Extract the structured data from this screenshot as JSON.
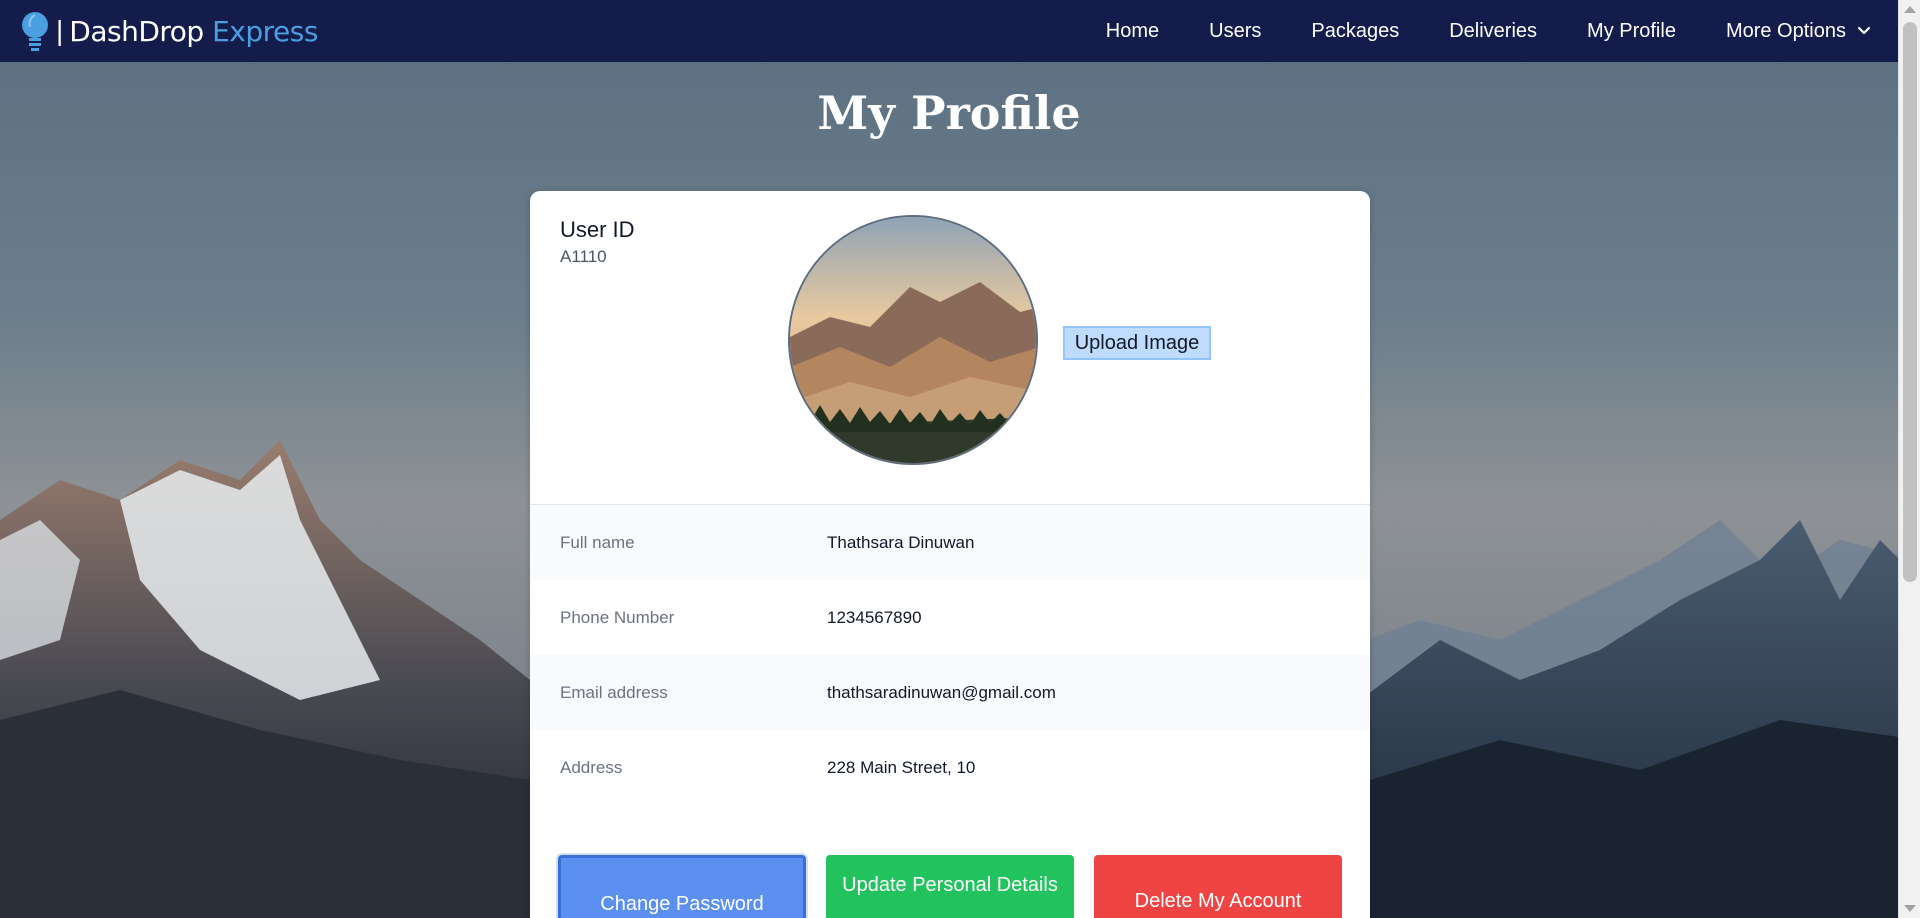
{
  "brand": {
    "name_part1": "DashDrop",
    "separator": "|",
    "name_part2": "Express"
  },
  "nav": {
    "items": [
      "Home",
      "Users",
      "Packages",
      "Deliveries",
      "My Profile"
    ],
    "more_label": "More Options"
  },
  "page": {
    "title": "My Profile"
  },
  "profile": {
    "user_id_label": "User ID",
    "user_id_value": "A1110",
    "upload_label": "Upload Image",
    "fields": [
      {
        "label": "Full name",
        "value": "Thathsara Dinuwan"
      },
      {
        "label": "Phone Number",
        "value": "1234567890"
      },
      {
        "label": "Email address",
        "value": "thathsaradinuwan@gmail.com"
      },
      {
        "label": "Address",
        "value": "228 Main Street, 10"
      }
    ]
  },
  "actions": {
    "change_password": "Change Password",
    "update_details": "Update Personal Details",
    "delete_account": "Delete My Account"
  },
  "colors": {
    "navbar": "#131c4b",
    "brand_accent": "#4a9fe0",
    "primary": "#5b8ff0",
    "success": "#22c35e",
    "danger": "#ef4444"
  },
  "icons": {
    "logo": "lightbulb-icon",
    "more": "chevron-down-icon"
  }
}
